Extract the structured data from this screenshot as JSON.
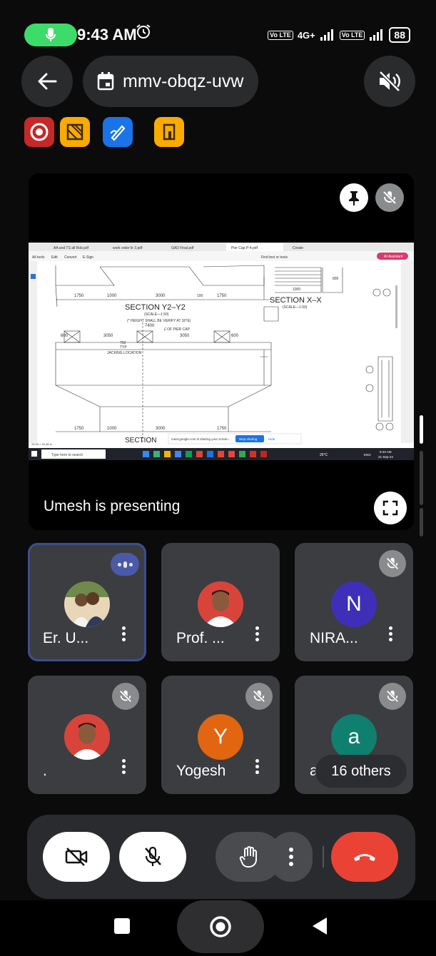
{
  "status": {
    "time": "9:43 AM",
    "battery": "88",
    "net_tag1": "Vo LTE",
    "net_type": "4G+",
    "net_tag2": "Vo LTE"
  },
  "meeting": {
    "code": "mmv-obqz-uvw"
  },
  "presentation": {
    "presenter_text": "Umesh is presenting",
    "screen": {
      "tabs": [
        "AA and TS all Rob.pdf",
        "work order lir 3.pdf",
        "GAD Final.pdf",
        "Pier Cap P-4.pdf",
        "Create"
      ],
      "menu": [
        "All tools",
        "Edit",
        "Convert",
        "E-Sign"
      ],
      "find_text": "Find text or tools",
      "ai_button": "AI Assistant",
      "section1_title": "SECTION Y2–Y2",
      "section1_scale": "(SCALE—1:50)",
      "section1_note": "(* HEIGHT SHALL BE VERIFY AT SITE)",
      "section2_title": "SECTION X–X",
      "section2_scale": "(SCALE—1:50)",
      "pier_label": "£ OF PIER CAP",
      "dim_7400": "7400",
      "dims_top": [
        "1750",
        "1000",
        "3000",
        "1750"
      ],
      "dim_100": "100",
      "dims_mid": [
        "600",
        "3050",
        "3050",
        "600"
      ],
      "dim_750": "750",
      "dim_typ": "TYP",
      "jacking": "JACKING LOCATION",
      "dims_bottom": [
        "1750",
        "1000",
        "3000",
        "1750"
      ],
      "dim_1000": "1000",
      "dim_800": "800",
      "section_cut": "SECTION",
      "share_text": "meet.google.com is sharing your screen.",
      "stop_sharing": "Stop sharing",
      "hide": "Hide",
      "search_placeholder": "Type here to search",
      "weather": "26°C",
      "lang": "ENG",
      "task_time": "9:43 AM",
      "task_date": "21-Sep-24",
      "page_num": "24.00 × 24.36 in"
    }
  },
  "participants": [
    {
      "name": "Er. U...",
      "initial": "",
      "color": "#7a6a58",
      "photo": true,
      "muted": false,
      "speaking": true
    },
    {
      "name": "Prof. ...",
      "initial": "",
      "color": "#c44b3b",
      "photo": true,
      "muted": false,
      "speaking": false
    },
    {
      "name": "NIRA...",
      "initial": "N",
      "color": "#3f2fb8",
      "photo": false,
      "muted": true,
      "speaking": false
    },
    {
      "name": ".",
      "initial": "",
      "color": "#c44b3b",
      "photo": true,
      "muted": true,
      "speaking": false
    },
    {
      "name": "Yogesh",
      "initial": "Y",
      "color": "#e2650f",
      "photo": false,
      "muted": true,
      "speaking": false
    },
    {
      "name": "aks...",
      "initial": "a",
      "color": "#0f7f6f",
      "photo": false,
      "muted": true,
      "speaking": false
    }
  ],
  "others_label": "16 others",
  "colors": {
    "mic_green": "#3ddc6a",
    "end_call_red": "#ea4335",
    "record_red": "#e53935",
    "tool_yellow": "#f9ab00",
    "tool_blue": "#1a73e8",
    "active_border": "#3b4f8f"
  },
  "icons": {
    "back": "arrow-left-icon",
    "calendar": "calendar-icon",
    "speaker": "speaker-off-icon",
    "pin": "pin-icon",
    "fullscreen": "fullscreen-icon",
    "camera": "camera-off-icon",
    "mic": "mic-off-icon",
    "hand": "raise-hand-icon",
    "more": "more-vert-icon",
    "end": "call-end-icon"
  }
}
